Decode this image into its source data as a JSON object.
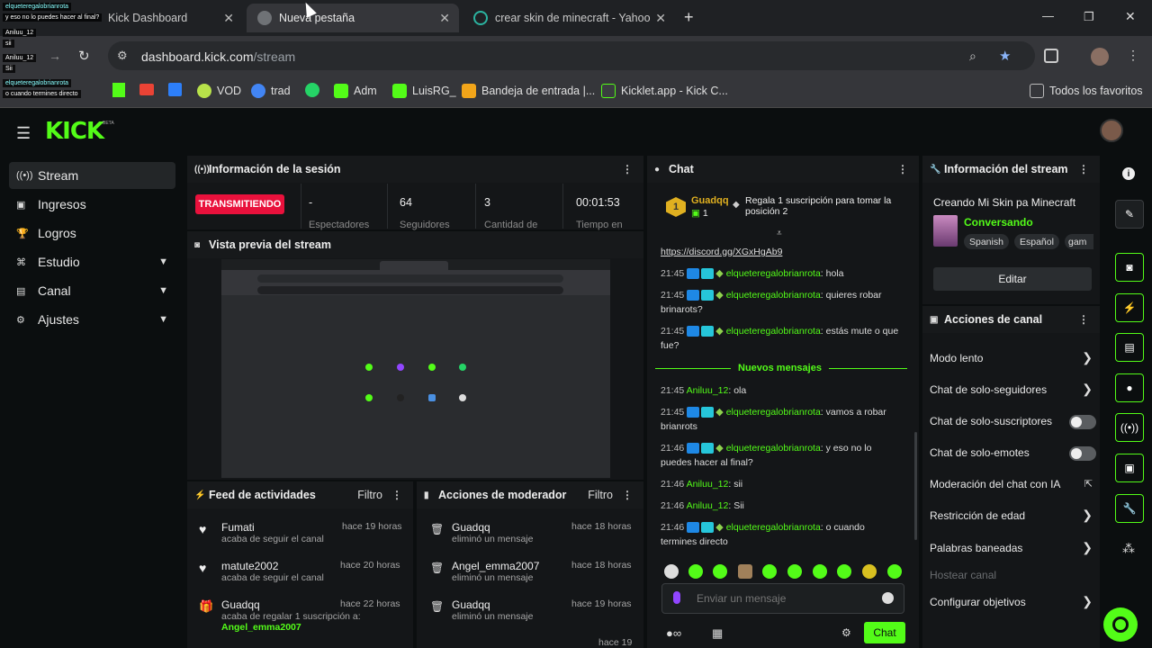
{
  "browser": {
    "tabs": [
      {
        "title": "Kick Dashboard",
        "close": "✕"
      },
      {
        "title": "Nueva pestaña",
        "close": "✕"
      },
      {
        "title": "crear skin de minecraft - Yahoo",
        "close": "✕"
      }
    ],
    "new_tab": "+",
    "url_domain": "dashboard.kick.com",
    "url_path": "/stream",
    "bookmarks": [
      "VOD",
      "trad",
      "Adm",
      "LuisRG_",
      "Bandeja de entrada |...",
      "Kicklet.app - Kick C..."
    ],
    "all_bookmarks": "Todos los favoritos",
    "window_controls": [
      "—",
      "❐",
      "✕"
    ]
  },
  "overlay_chat": [
    {
      "user": "elqueteregalobrianrota",
      "text": "y eso no lo puedes hacer al final?"
    },
    {
      "user": "Aniluu_12",
      "text": "sii"
    },
    {
      "user": "Aniluu_12",
      "text": "Sii"
    },
    {
      "user": "elqueteregalobrianrota",
      "text": "o cuando termines directo"
    }
  ],
  "kick": {
    "logo": "KICK",
    "beta": "BETA"
  },
  "sidebar": {
    "items": [
      {
        "label": "Stream",
        "icon": "broadcast-icon",
        "expand": false
      },
      {
        "label": "Ingresos",
        "icon": "wallet-icon",
        "expand": false
      },
      {
        "label": "Logros",
        "icon": "trophy-icon",
        "expand": false
      },
      {
        "label": "Estudio",
        "icon": "studio-icon",
        "expand": true
      },
      {
        "label": "Canal",
        "icon": "channel-icon",
        "expand": true
      },
      {
        "label": "Ajustes",
        "icon": "gear-icon",
        "expand": true
      }
    ]
  },
  "session": {
    "title": "Información de la sesión",
    "live_badge": "TRANSMITIENDO",
    "stats": [
      {
        "value": "-",
        "label": "Espectadores"
      },
      {
        "value": "64",
        "label": "Seguidores"
      },
      {
        "value": "3",
        "label": "Cantidad de"
      },
      {
        "value": "00:01:53",
        "label": "Tiempo en"
      }
    ]
  },
  "preview": {
    "title": "Vista previa del stream"
  },
  "feed": {
    "title": "Feed de actividades",
    "filter": "Filtro",
    "items": [
      {
        "name": "Fumati",
        "sub": "acaba de seguir el canal",
        "time": "hace 19 horas",
        "extra": ""
      },
      {
        "name": "matute2002",
        "sub": "acaba de seguir el canal",
        "time": "hace 20 horas",
        "extra": ""
      },
      {
        "name": "Guadqq",
        "sub": "acaba de regalar 1 suscripción a:",
        "time": "hace 22 horas",
        "extra": "Angel_emma2007"
      }
    ]
  },
  "modactions": {
    "title": "Acciones de moderador",
    "filter": "Filtro",
    "items": [
      {
        "name": "Guadqq",
        "sub": "eliminó un mensaje",
        "time": "hace 18 horas"
      },
      {
        "name": "Angel_emma2007",
        "sub": "eliminó un mensaje",
        "time": "hace 18 horas"
      },
      {
        "name": "Guadqq",
        "sub": "eliminó un mensaje",
        "time": "hace 19 horas"
      }
    ],
    "partial_time": "hace 19"
  },
  "chat": {
    "title": "Chat",
    "pinned_user": "Guadqq",
    "pinned_count": "1",
    "pinned_rank": "1",
    "pinned_text": "Regala 1 suscripción para tomar la posición 2",
    "link": "https://discord.gg/XGxHgAb9",
    "new_messages": "Nuevos mensajes",
    "messages": [
      {
        "time": "21:45",
        "user": "elqueteregalobrianrota",
        "text": "hola",
        "badges": true
      },
      {
        "time": "21:45",
        "user": "elqueteregalobrianrota",
        "text": "quieres robar brinarots?",
        "badges": true
      },
      {
        "time": "21:45",
        "user": "elqueteregalobrianrota",
        "text": "estás mute o que fue?",
        "badges": true
      },
      {
        "time": "21:45",
        "user": "Aniluu_12",
        "text": "ola",
        "badges": false
      },
      {
        "time": "21:45",
        "user": "elqueteregalobrianrota",
        "text": "vamos a robar brianrots",
        "badges": true
      },
      {
        "time": "21:46",
        "user": "elqueteregalobrianrota",
        "text": "y eso no lo puedes hacer al final?",
        "badges": true
      },
      {
        "time": "21:46",
        "user": "Aniluu_12",
        "text": "sii",
        "badges": false
      },
      {
        "time": "21:46",
        "user": "Aniluu_12",
        "text": "Sii",
        "badges": false
      },
      {
        "time": "21:46",
        "user": "elqueteregalobrianrota",
        "text": "o cuando termines directo",
        "badges": true
      }
    ],
    "input_placeholder": "Enviar un mensaje",
    "send_label": "Chat"
  },
  "streaminfo": {
    "title": "Información del stream",
    "stream_title": "Creando Mi Skin pa Minecraft",
    "category": "Conversando",
    "tags": [
      "Spanish",
      "Español",
      "gam"
    ],
    "edit_label": "Editar"
  },
  "channelactions": {
    "title": "Acciones de canal",
    "items": [
      {
        "label": "Modo lento",
        "control": "arrow"
      },
      {
        "label": "Chat de solo-seguidores",
        "control": "arrow"
      },
      {
        "label": "Chat de solo-suscriptores",
        "control": "toggle"
      },
      {
        "label": "Chat de solo-emotes",
        "control": "toggle"
      },
      {
        "label": "Moderación del chat con IA",
        "control": "external"
      },
      {
        "label": "Restricción de edad",
        "control": "arrow"
      },
      {
        "label": "Palabras baneadas",
        "control": "arrow"
      },
      {
        "label": "Hostear canal",
        "control": "none"
      },
      {
        "label": "Configurar objetivos",
        "control": "arrow"
      }
    ]
  },
  "colors": {
    "accent": "#53fc18",
    "live": "#e9113c",
    "background": "#0b0e0f",
    "panel": "#141618"
  }
}
